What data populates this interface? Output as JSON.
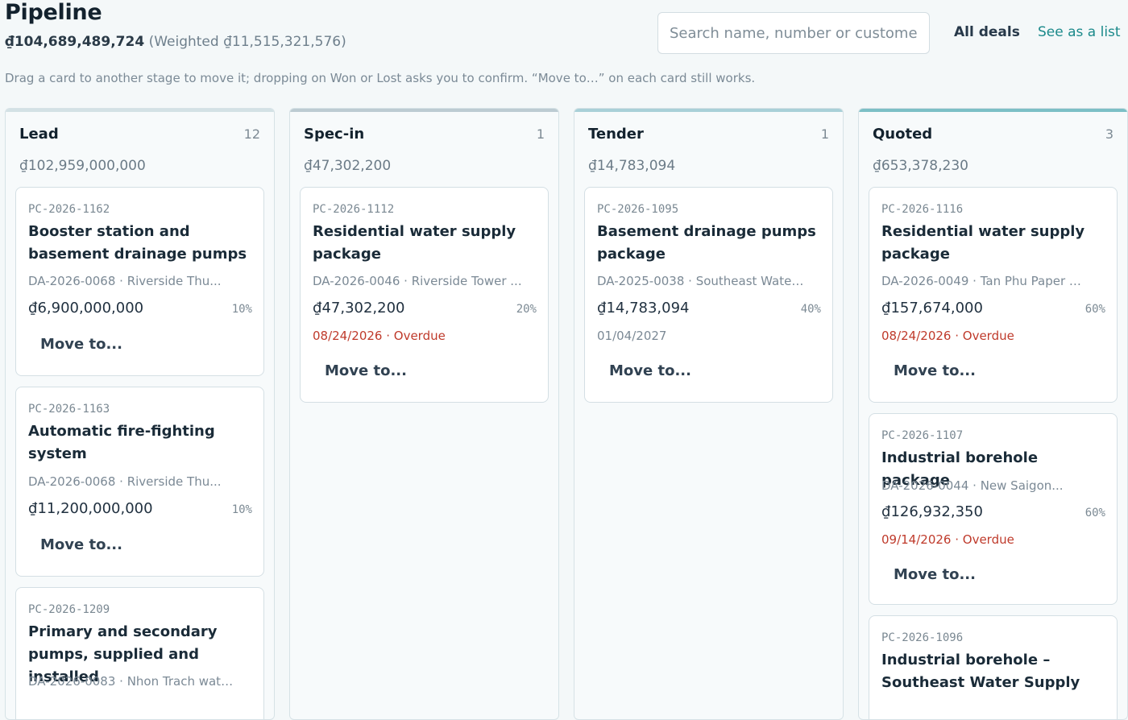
{
  "header": {
    "title": "Pipeline",
    "total": "₫104,689,489,724",
    "weighted": "(Weighted ₫11,515,321,576)",
    "search_placeholder": "Search name, number or customer",
    "all_deals": "All deals",
    "see_as_list": "See as a list",
    "hint": "Drag a card to another stage to move it; dropping on Won or Lost asks you to confirm. “Move to…” on each card still works."
  },
  "colors": {
    "lead_bar": "#d3e1e5",
    "specin_bar": "#bccbd2",
    "tender_bar": "#a9d0d8",
    "quoted_bar": "#7cbfc6",
    "overdue": "#bf3a2b",
    "link": "#1c8a8b"
  },
  "columns": {
    "lead": {
      "name": "Lead",
      "count": "12",
      "sum": "₫102,959,000,000",
      "cards": [
        {
          "number": "PC-2026-1162",
          "title": "Booster station and basement drainage pumps",
          "sub": "DA-2026-0068 · Riverside Thu...",
          "amount": "₫6,900,000,000",
          "pct": "10%",
          "move": "Move to..."
        },
        {
          "number": "PC-2026-1163",
          "title": "Automatic fire-fighting system",
          "sub": "DA-2026-0068 · Riverside Thu...",
          "amount": "₫11,200,000,000",
          "pct": "10%",
          "move": "Move to..."
        },
        {
          "number": "PC-2026-1209",
          "title": "Primary and secondary pumps, supplied and installed",
          "sub": "DA-2026-0083 · Nhon Trach wate..."
        }
      ]
    },
    "specin": {
      "name": "Spec-in",
      "count": "1",
      "sum": "₫47,302,200",
      "cards": [
        {
          "number": "PC-2026-1112",
          "title": "Residential water supply package",
          "sub": "DA-2026-0046 · Riverside Tower ...",
          "amount": "₫47,302,200",
          "pct": "20%",
          "date": "08/24/2026 · Overdue",
          "move": "Move to..."
        }
      ]
    },
    "tender": {
      "name": "Tender",
      "count": "1",
      "sum": "₫14,783,094",
      "cards": [
        {
          "number": "PC-2026-1095",
          "title": "Basement drainage pumps package",
          "sub": "DA-2025-0038 · Southeast Water...",
          "amount": "₫14,783,094",
          "pct": "40%",
          "date": "01/04/2027",
          "move": "Move to..."
        }
      ]
    },
    "quoted": {
      "name": "Quoted",
      "count": "3",
      "sum": "₫653,378,230",
      "cards": [
        {
          "number": "PC-2026-1116",
          "title": "Residential water supply package",
          "sub": "DA-2026-0049 · Tan Phu Paper Mi...",
          "amount": "₫157,674,000",
          "pct": "60%",
          "date": "08/24/2026 · Overdue",
          "move": "Move to..."
        },
        {
          "number": "PC-2026-1107",
          "title": "Industrial borehole package",
          "sub": "DA-2026-0044 · New Saigon...",
          "amount": "₫126,932,350",
          "pct": "60%",
          "date": "09/14/2026 · Overdue",
          "move": "Move to..."
        },
        {
          "number": "PC-2026-1096",
          "title": "Industrial borehole – Southeast Water Supply"
        }
      ]
    }
  }
}
